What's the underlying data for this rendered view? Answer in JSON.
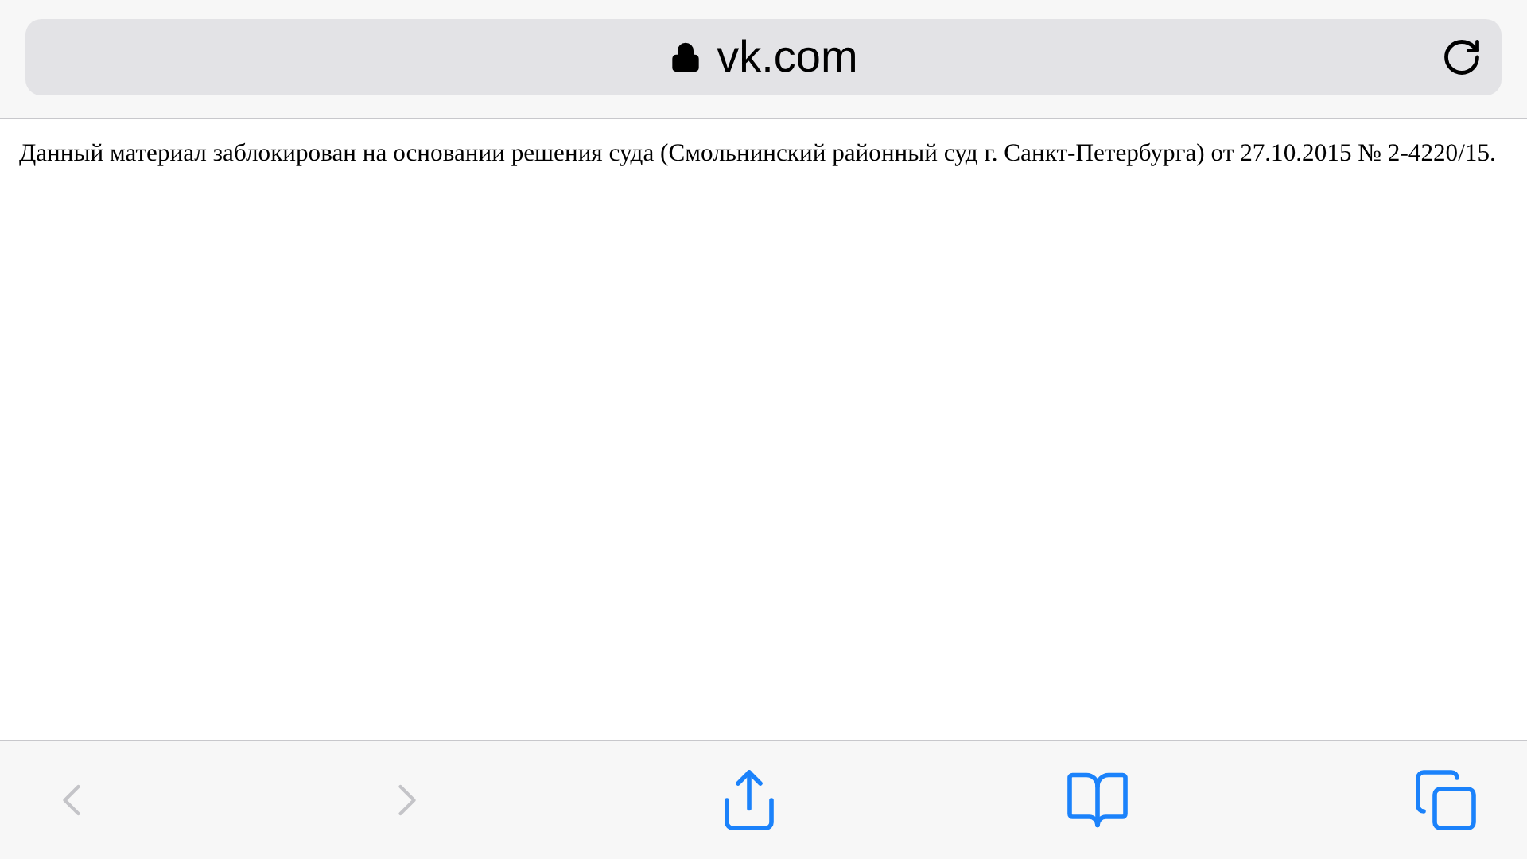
{
  "address_bar": {
    "url": "vk.com",
    "secure": true
  },
  "page": {
    "message": "Данный материал заблокирован на основании решения суда (Смольнинский районный суд г. Санкт-Петербурга) от 27.10.2015 № 2-4220/15."
  },
  "toolbar": [
    {
      "kind": "back",
      "disabled": true
    },
    {
      "kind": "forward",
      "disabled": true
    },
    {
      "kind": "share",
      "disabled": false
    },
    {
      "kind": "bookmarks",
      "disabled": false
    },
    {
      "kind": "tabs",
      "disabled": false
    }
  ]
}
